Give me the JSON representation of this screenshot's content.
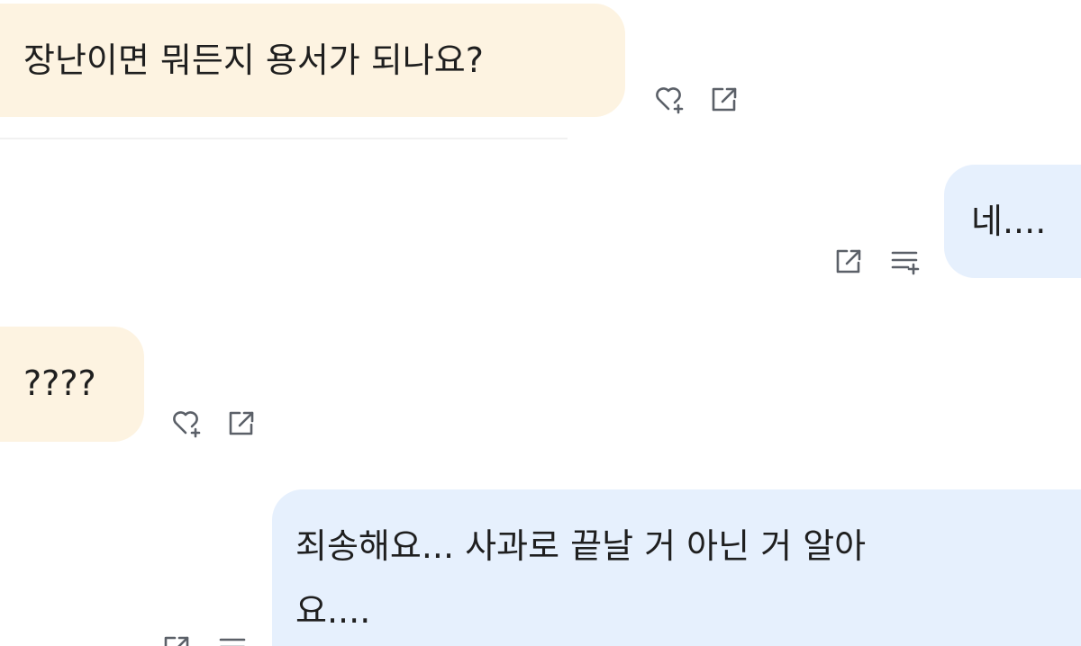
{
  "messages": [
    {
      "role": "bot",
      "text": "장난이면 뭐든지 용서가 되나요?",
      "actions": [
        "heart-plus-icon",
        "share-icon"
      ]
    },
    {
      "role": "user",
      "text": "네....",
      "actions": [
        "share-icon",
        "edit-list-icon"
      ]
    },
    {
      "role": "bot",
      "text": "????",
      "actions": [
        "heart-plus-icon",
        "share-icon"
      ]
    },
    {
      "role": "user",
      "line1": "죄송해요... 사과로 끝날 거 아닌 거 알아",
      "line2": "요....",
      "actions": [
        "share-icon",
        "edit-list-icon"
      ]
    }
  ],
  "colors": {
    "bot_bubble": "#fdf3e1",
    "user_bubble": "#e6f0fd",
    "icon": "#5b6068",
    "text": "#1f1f1f"
  }
}
